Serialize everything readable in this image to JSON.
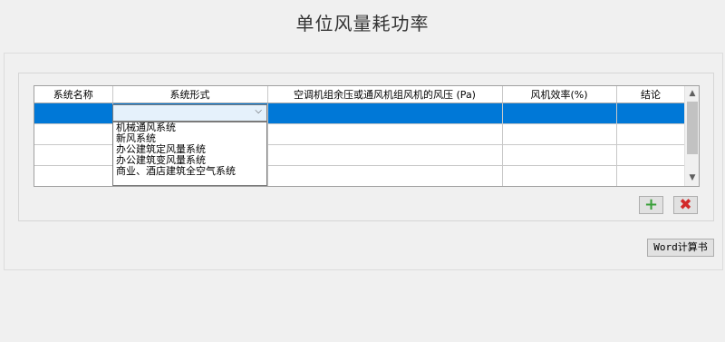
{
  "page": {
    "title": "单位风量耗功率"
  },
  "table": {
    "columns": [
      "系统名称",
      "系统形式",
      "空调机组余压或通风机组风机的风压 (Pa)",
      "风机效率(%)",
      "结论"
    ],
    "rows": [
      [
        "",
        "",
        "",
        "",
        ""
      ],
      [
        "",
        "",
        "",
        "",
        ""
      ],
      [
        "",
        "",
        "",
        "",
        ""
      ],
      [
        "",
        "",
        "",
        "",
        ""
      ]
    ],
    "selected_row": 0
  },
  "dropdown": {
    "value": "",
    "options": [
      "机械通风系统",
      "新风系统",
      "办公建筑定风量系统",
      "办公建筑变风量系统",
      "商业、酒店建筑全空气系统"
    ]
  },
  "buttons": {
    "add": "+",
    "delete": "✖",
    "word": "Word计算书"
  },
  "scrollbar": {
    "up": "▲",
    "down": "▼"
  },
  "icons": {
    "combo_chevron": "⌵"
  }
}
